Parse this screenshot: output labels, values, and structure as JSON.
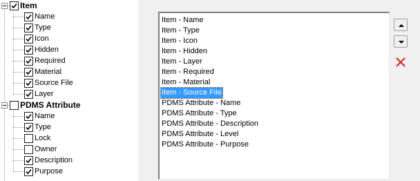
{
  "tree": {
    "groups": [
      {
        "label": "Item",
        "checked": true,
        "expanded": true,
        "children": [
          {
            "label": "Name",
            "checked": true
          },
          {
            "label": "Type",
            "checked": true
          },
          {
            "label": "Icon",
            "checked": true
          },
          {
            "label": "Hidden",
            "checked": true
          },
          {
            "label": "Required",
            "checked": true
          },
          {
            "label": "Material",
            "checked": true
          },
          {
            "label": "Source File",
            "checked": true
          },
          {
            "label": "Layer",
            "checked": true
          }
        ]
      },
      {
        "label": "PDMS Attribute",
        "checked": false,
        "expanded": true,
        "children": [
          {
            "label": "Name",
            "checked": true
          },
          {
            "label": "Type",
            "checked": true
          },
          {
            "label": "Lock",
            "checked": false
          },
          {
            "label": "Owner",
            "checked": false
          },
          {
            "label": "Description",
            "checked": true
          },
          {
            "label": "Purpose",
            "checked": true
          }
        ]
      }
    ]
  },
  "selected_list": {
    "items": [
      "Item - Name",
      "Item - Type",
      "Item - Icon",
      "Item - Hidden",
      "Item - Layer",
      "Item - Required",
      "Item - Material",
      "Item - Source File",
      "PDMS Attribute - Name",
      "PDMS Attribute - Type",
      "PDMS Attribute - Description",
      "PDMS Attribute - Level",
      "PDMS Attribute - Purpose"
    ],
    "selected_item": "Item - Source File"
  },
  "buttons": {
    "move_up_icon": "arrow-up-icon",
    "move_down_icon": "arrow-down-icon",
    "remove_icon": "red-x-icon"
  },
  "colors": {
    "selection": "#3399ff",
    "remove": "#e02020"
  }
}
